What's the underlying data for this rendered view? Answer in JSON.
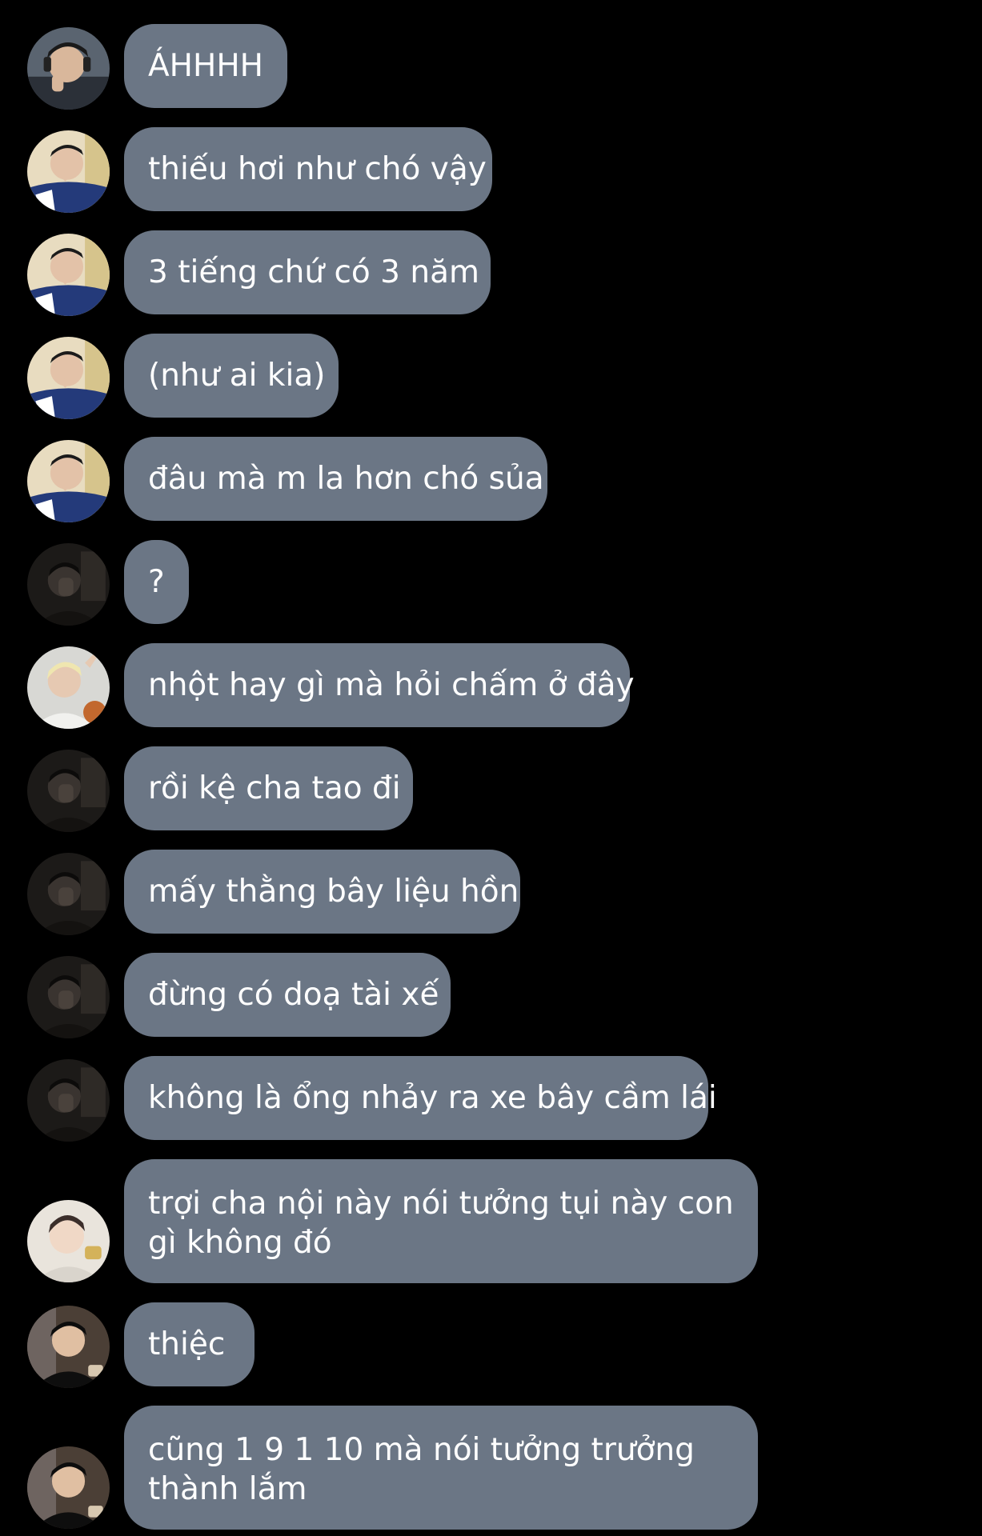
{
  "messages": [
    {
      "text": "ÁHHHH",
      "avatar": "avatar-boy-headphones"
    },
    {
      "text": "thiếu hơi như chó vậy",
      "avatar": "avatar-boy-varsity"
    },
    {
      "text": "3 tiếng chứ có 3 năm",
      "avatar": "avatar-boy-varsity"
    },
    {
      "text": "(như ai kia)",
      "avatar": "avatar-boy-varsity"
    },
    {
      "text": "đâu mà m la hơn chó sủa",
      "avatar": "avatar-boy-varsity"
    },
    {
      "text": "?",
      "avatar": "avatar-dark-hand"
    },
    {
      "text": "nhột hay gì mà hỏi chấm ở đây",
      "avatar": "avatar-blond-basketball"
    },
    {
      "text": "rồi kệ cha tao đi",
      "avatar": "avatar-dark-hand"
    },
    {
      "text": "mấy thằng bây liệu hồn",
      "avatar": "avatar-dark-hand"
    },
    {
      "text": "đừng có doạ tài xế",
      "avatar": "avatar-dark-hand"
    },
    {
      "text": "không là ổng nhảy ra xe bây cầm lái",
      "avatar": "avatar-dark-hand"
    },
    {
      "text": "trợi cha nội này nói tưởng tụi này con gì không đó",
      "avatar": "avatar-light-boy"
    },
    {
      "text": "thiệc",
      "avatar": "avatar-boy-black-shirt"
    },
    {
      "text": "cũng 1 9 1 10 mà nói tưởng trưởng thành lắm",
      "avatar": "avatar-boy-black-shirt"
    }
  ],
  "colors": {
    "background": "#000000",
    "bubble": "#6b7685",
    "text": "#ffffff"
  }
}
